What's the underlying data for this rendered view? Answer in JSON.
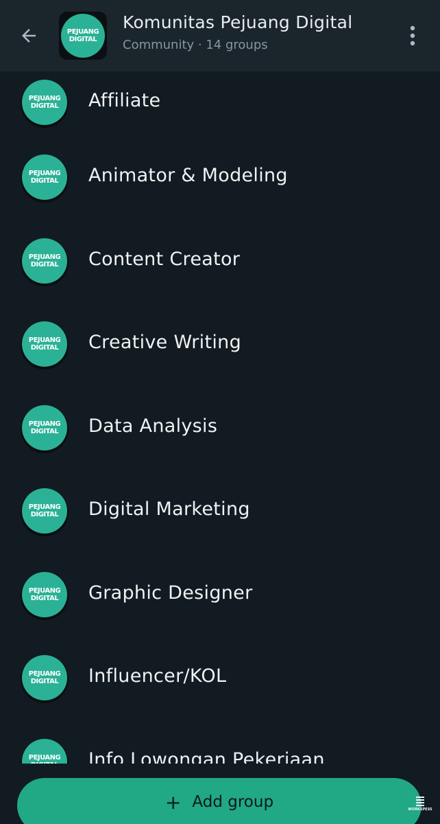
{
  "header": {
    "title": "Komunitas Pejuang Digital",
    "subtitle": "Community · 14 groups",
    "icons": [
      "arrow-left-icon",
      "more-vertical-icon"
    ]
  },
  "logo": {
    "line1": "PEJUANG",
    "line2": "DIGITAL"
  },
  "groups": [
    {
      "name": "Affiliate"
    },
    {
      "name": "Animator & Modeling"
    },
    {
      "name": "Content Creator"
    },
    {
      "name": "Creative Writing"
    },
    {
      "name": "Data Analysis"
    },
    {
      "name": "Digital Marketing"
    },
    {
      "name": "Graphic Designer"
    },
    {
      "name": "Influencer/KOL"
    },
    {
      "name": "Info Lowongan Pekerjaan"
    }
  ],
  "add_group": {
    "label": "Add group",
    "icon": "plus-icon"
  },
  "watermark": "WORKSPESS",
  "colors": {
    "background": "#111b21",
    "header": "#1b252c",
    "accent": "#21a884",
    "logo_disc": "#2bb196"
  }
}
